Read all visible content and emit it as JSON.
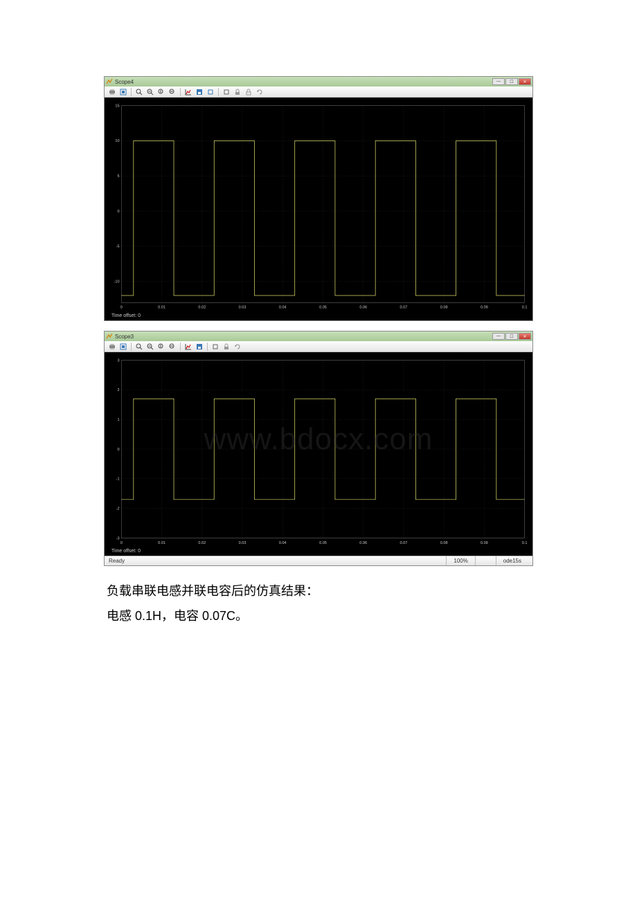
{
  "watermark": "www.bdocx.com",
  "scope1": {
    "title": "Scope4",
    "time_offset_label": "Time offset: 0",
    "y_ticks": [
      -10,
      -5,
      0,
      5,
      10,
      15
    ],
    "x_ticks": [
      0,
      0.01,
      0.02,
      0.03,
      0.04,
      0.05,
      0.06,
      0.07,
      0.08,
      0.09,
      0.1
    ]
  },
  "scope2": {
    "title": "Scope3",
    "time_offset_label": "Time offset: 0",
    "y_ticks": [
      -3,
      -2,
      -1,
      0,
      1,
      2,
      3
    ],
    "x_ticks": [
      0,
      0.01,
      0.02,
      0.03,
      0.04,
      0.05,
      0.06,
      0.07,
      0.08,
      0.09,
      0.1
    ],
    "status": {
      "ready": "Ready",
      "zoom": "100%",
      "solver": "ode15s"
    }
  },
  "toolbar_icons": [
    "print",
    "params",
    "zoom-in",
    "zoom-out",
    "zoom-y",
    "zoom-x",
    "autoscale",
    "save",
    "restore",
    "float",
    "lock",
    "lock2",
    "sync"
  ],
  "body": {
    "line1": "负载串联电感并联电容后的仿真结果：",
    "line2": "电感 0.1H，电容 0.07C。"
  },
  "chart_data": [
    {
      "type": "line",
      "title": "Scope4",
      "xlabel": "",
      "ylabel": "",
      "xlim": [
        0,
        0.1
      ],
      "ylim": [
        -13,
        15
      ],
      "x_ticks": [
        0,
        0.01,
        0.02,
        0.03,
        0.04,
        0.05,
        0.06,
        0.07,
        0.08,
        0.09,
        0.1
      ],
      "y_ticks": [
        -10,
        -5,
        0,
        5,
        10,
        15
      ],
      "series": [
        {
          "name": "signal",
          "x": [
            0,
            0.003,
            0.003,
            0.013,
            0.013,
            0.023,
            0.023,
            0.033,
            0.033,
            0.043,
            0.043,
            0.053,
            0.053,
            0.063,
            0.063,
            0.073,
            0.073,
            0.083,
            0.083,
            0.093,
            0.093,
            0.1
          ],
          "values": [
            -12,
            -12,
            10,
            10,
            -12,
            -12,
            10,
            10,
            -12,
            -12,
            10,
            10,
            -12,
            -12,
            10,
            10,
            -12,
            -12,
            10,
            10,
            -12,
            -12
          ]
        }
      ]
    },
    {
      "type": "line",
      "title": "Scope3",
      "xlabel": "",
      "ylabel": "",
      "xlim": [
        0,
        0.1
      ],
      "ylim": [
        -3,
        3
      ],
      "x_ticks": [
        0,
        0.01,
        0.02,
        0.03,
        0.04,
        0.05,
        0.06,
        0.07,
        0.08,
        0.09,
        0.1
      ],
      "y_ticks": [
        -3,
        -2,
        -1,
        0,
        1,
        2,
        3
      ],
      "series": [
        {
          "name": "signal",
          "x": [
            0,
            0.003,
            0.003,
            0.013,
            0.013,
            0.023,
            0.023,
            0.033,
            0.033,
            0.043,
            0.043,
            0.053,
            0.053,
            0.063,
            0.063,
            0.073,
            0.073,
            0.083,
            0.083,
            0.093,
            0.093,
            0.1
          ],
          "values": [
            -1.7,
            -1.7,
            1.7,
            1.7,
            -1.7,
            -1.7,
            1.7,
            1.7,
            -1.7,
            -1.7,
            1.7,
            1.7,
            -1.7,
            -1.7,
            1.7,
            1.7,
            -1.7,
            -1.7,
            1.7,
            1.7,
            -1.7,
            -1.7
          ]
        }
      ]
    }
  ]
}
